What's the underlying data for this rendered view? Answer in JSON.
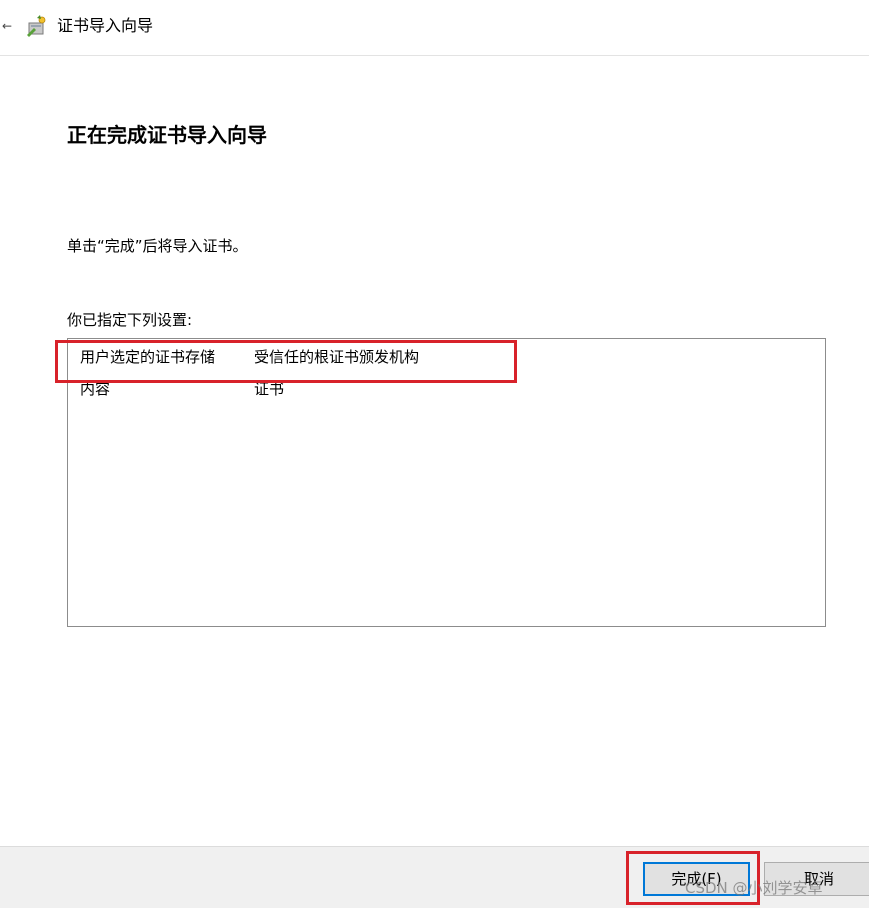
{
  "window": {
    "back_glyph": "←",
    "icon": "certificate-import-icon",
    "title": "证书导入向导"
  },
  "main": {
    "heading": "正在完成证书导入向导",
    "instruction": "单击“完成”后将导入证书。",
    "settings_label": "你已指定下列设置:",
    "settings": [
      {
        "key": "用户选定的证书存储",
        "value": "受信任的根证书颁发机构"
      },
      {
        "key": "内容",
        "value": "证书"
      }
    ]
  },
  "footer": {
    "finish_label": "完成(F)",
    "cancel_label": "取消"
  },
  "watermark": "CSDN @小刘学安卓",
  "colors": {
    "highlight": "#d8222a",
    "focus_border": "#0078d7",
    "footer_bg": "#f0f0f0"
  }
}
